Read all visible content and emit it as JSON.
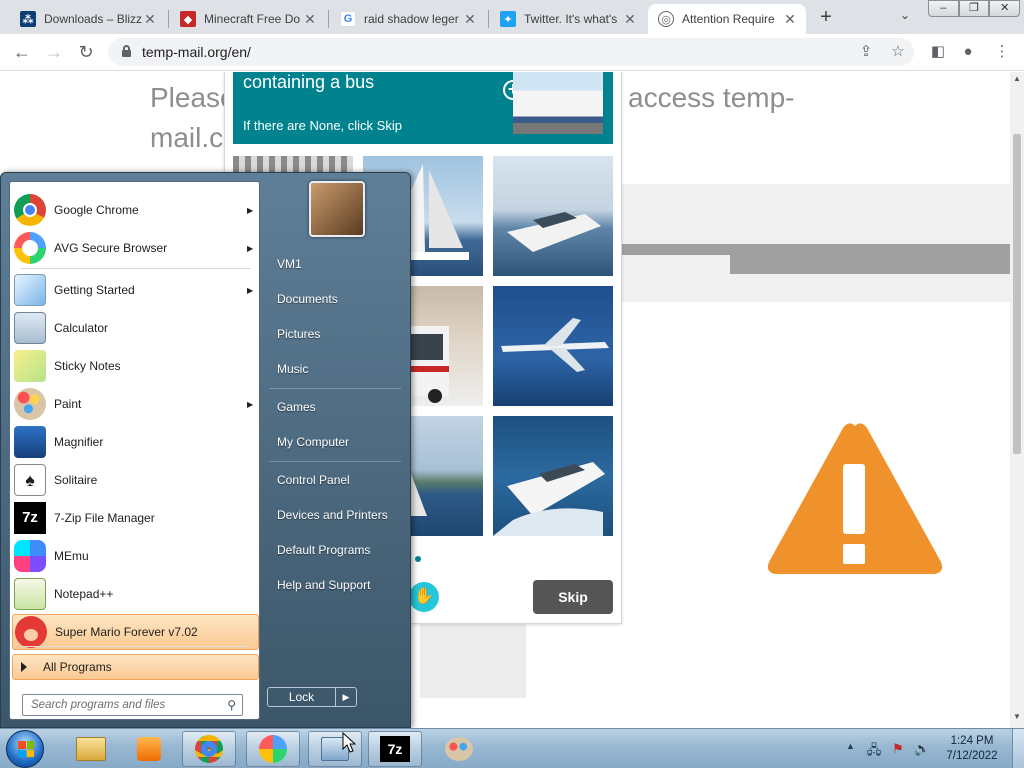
{
  "browser": {
    "tabs": [
      {
        "title": "Downloads – Blizz",
        "favicon": "blizzard-icon",
        "color": "#0b3d75"
      },
      {
        "title": "Minecraft Free Do",
        "favicon": "gamepad-icon",
        "color": "#c62828"
      },
      {
        "title": "raid shadow leger",
        "favicon": "google-icon",
        "color": "#4285f4"
      },
      {
        "title": "Twitter. It's what's",
        "favicon": "twitter-icon",
        "color": "#1da1f2"
      },
      {
        "title": "Attention Require",
        "favicon": "globe-icon",
        "color": "#5f6368",
        "active": true
      }
    ],
    "url": "temp-mail.org/en/"
  },
  "page": {
    "headline_part1": "Please",
    "headline_part2": "access temp-",
    "headline_part3": "mail.c",
    "captcha": {
      "title": "containing a bus",
      "subtitle": "If there are None, click Skip",
      "skip_label": "Skip",
      "brand_color": "#00838f",
      "images": [
        "building",
        "sailboat",
        "speedboat",
        "bus",
        "airplane",
        "sailboat",
        "yacht"
      ]
    },
    "warning_color": "#f0922b"
  },
  "start_menu": {
    "programs": [
      {
        "label": "Google Chrome",
        "icon": "chrome-icon",
        "submenu": true
      },
      {
        "label": "AVG Secure Browser",
        "icon": "avg-browser-icon",
        "submenu": true
      },
      {
        "label": "Getting Started",
        "icon": "getting-started-icon",
        "submenu": true
      },
      {
        "label": "Calculator",
        "icon": "calculator-icon",
        "submenu": false
      },
      {
        "label": "Sticky Notes",
        "icon": "sticky-notes-icon",
        "submenu": false
      },
      {
        "label": "Paint",
        "icon": "paint-icon",
        "submenu": true
      },
      {
        "label": "Magnifier",
        "icon": "magnifier-icon",
        "submenu": false
      },
      {
        "label": "Solitaire",
        "icon": "solitaire-icon",
        "submenu": false
      },
      {
        "label": "7-Zip File Manager",
        "icon": "7zip-icon",
        "submenu": false
      },
      {
        "label": "MEmu",
        "icon": "memu-icon",
        "submenu": false
      },
      {
        "label": "Notepad++",
        "icon": "notepadpp-icon",
        "submenu": false
      },
      {
        "label": "Super Mario Forever v7.02",
        "icon": "mario-icon",
        "submenu": false,
        "highlighted": true
      }
    ],
    "all_programs": "All Programs",
    "search_placeholder": "Search programs and files",
    "right_items": [
      "VM1",
      "Documents",
      "Pictures",
      "Music",
      "Games",
      "My Computer",
      "Control Panel",
      "Devices and Printers",
      "Default Programs",
      "Help and Support"
    ],
    "lock_label": "Lock"
  },
  "taskbar": {
    "pinned": [
      "explorer-icon",
      "media-player-icon",
      "chrome-icon",
      "avg-browser-icon",
      "control-panel-icon",
      "7zip-icon",
      "paint-icon"
    ],
    "clock_time": "1:24 PM",
    "clock_date": "7/12/2022"
  }
}
